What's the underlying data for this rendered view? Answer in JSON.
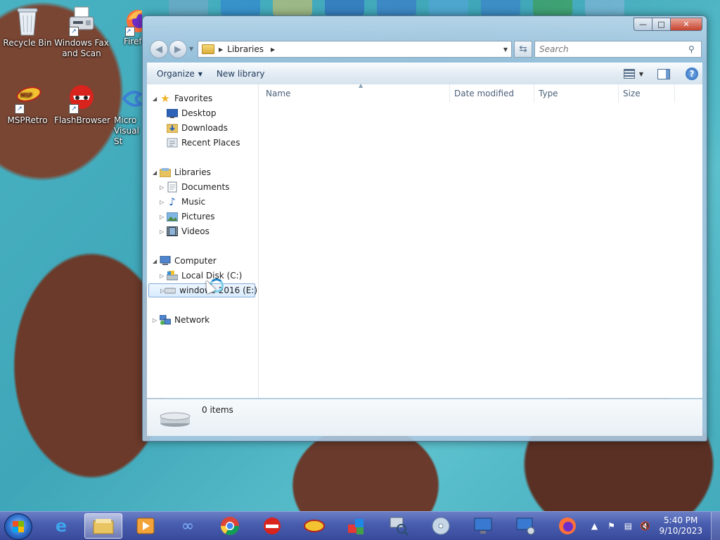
{
  "desktop": {
    "icons": [
      {
        "label_line1": "Recycle Bin",
        "label_line2": ""
      },
      {
        "label_line1": "Windows Fax",
        "label_line2": "and Scan"
      },
      {
        "label_line1": "Firef",
        "label_line2": ""
      },
      {
        "label_line1": "MSPRetro",
        "label_line2": ""
      },
      {
        "label_line1": "FlashBrowser",
        "label_line2": ""
      },
      {
        "label_line1": "Micro",
        "label_line2": "Visual St"
      }
    ]
  },
  "window": {
    "caption": {
      "minimize": "—",
      "maximize": "□",
      "close": "✕"
    },
    "address": {
      "crumb": "Libraries"
    },
    "search": {
      "placeholder": "Search"
    },
    "toolbar": {
      "organize": "Organize",
      "new_library": "New library"
    },
    "nav_tree": {
      "favorites": "Favorites",
      "desktop": "Desktop",
      "downloads": "Downloads",
      "recent_places": "Recent Places",
      "libraries": "Libraries",
      "documents": "Documents",
      "music": "Music",
      "pictures": "Pictures",
      "videos": "Videos",
      "computer": "Computer",
      "local_disk": "Local Disk (C:)",
      "windows_drive": "windows 2016 (E:)",
      "network": "Network"
    },
    "columns": [
      "Name",
      "Date modified",
      "Type",
      "Size"
    ],
    "details": {
      "count": "0 items"
    }
  },
  "taskbar": {
    "clock_time": "5:40 PM",
    "clock_date": "9/10/2023"
  },
  "colors": {
    "taskbar": "#4a5fb0",
    "window_frame": "#a9c6de",
    "selection": "#d8ebfd",
    "close_button": "#c7432d"
  }
}
